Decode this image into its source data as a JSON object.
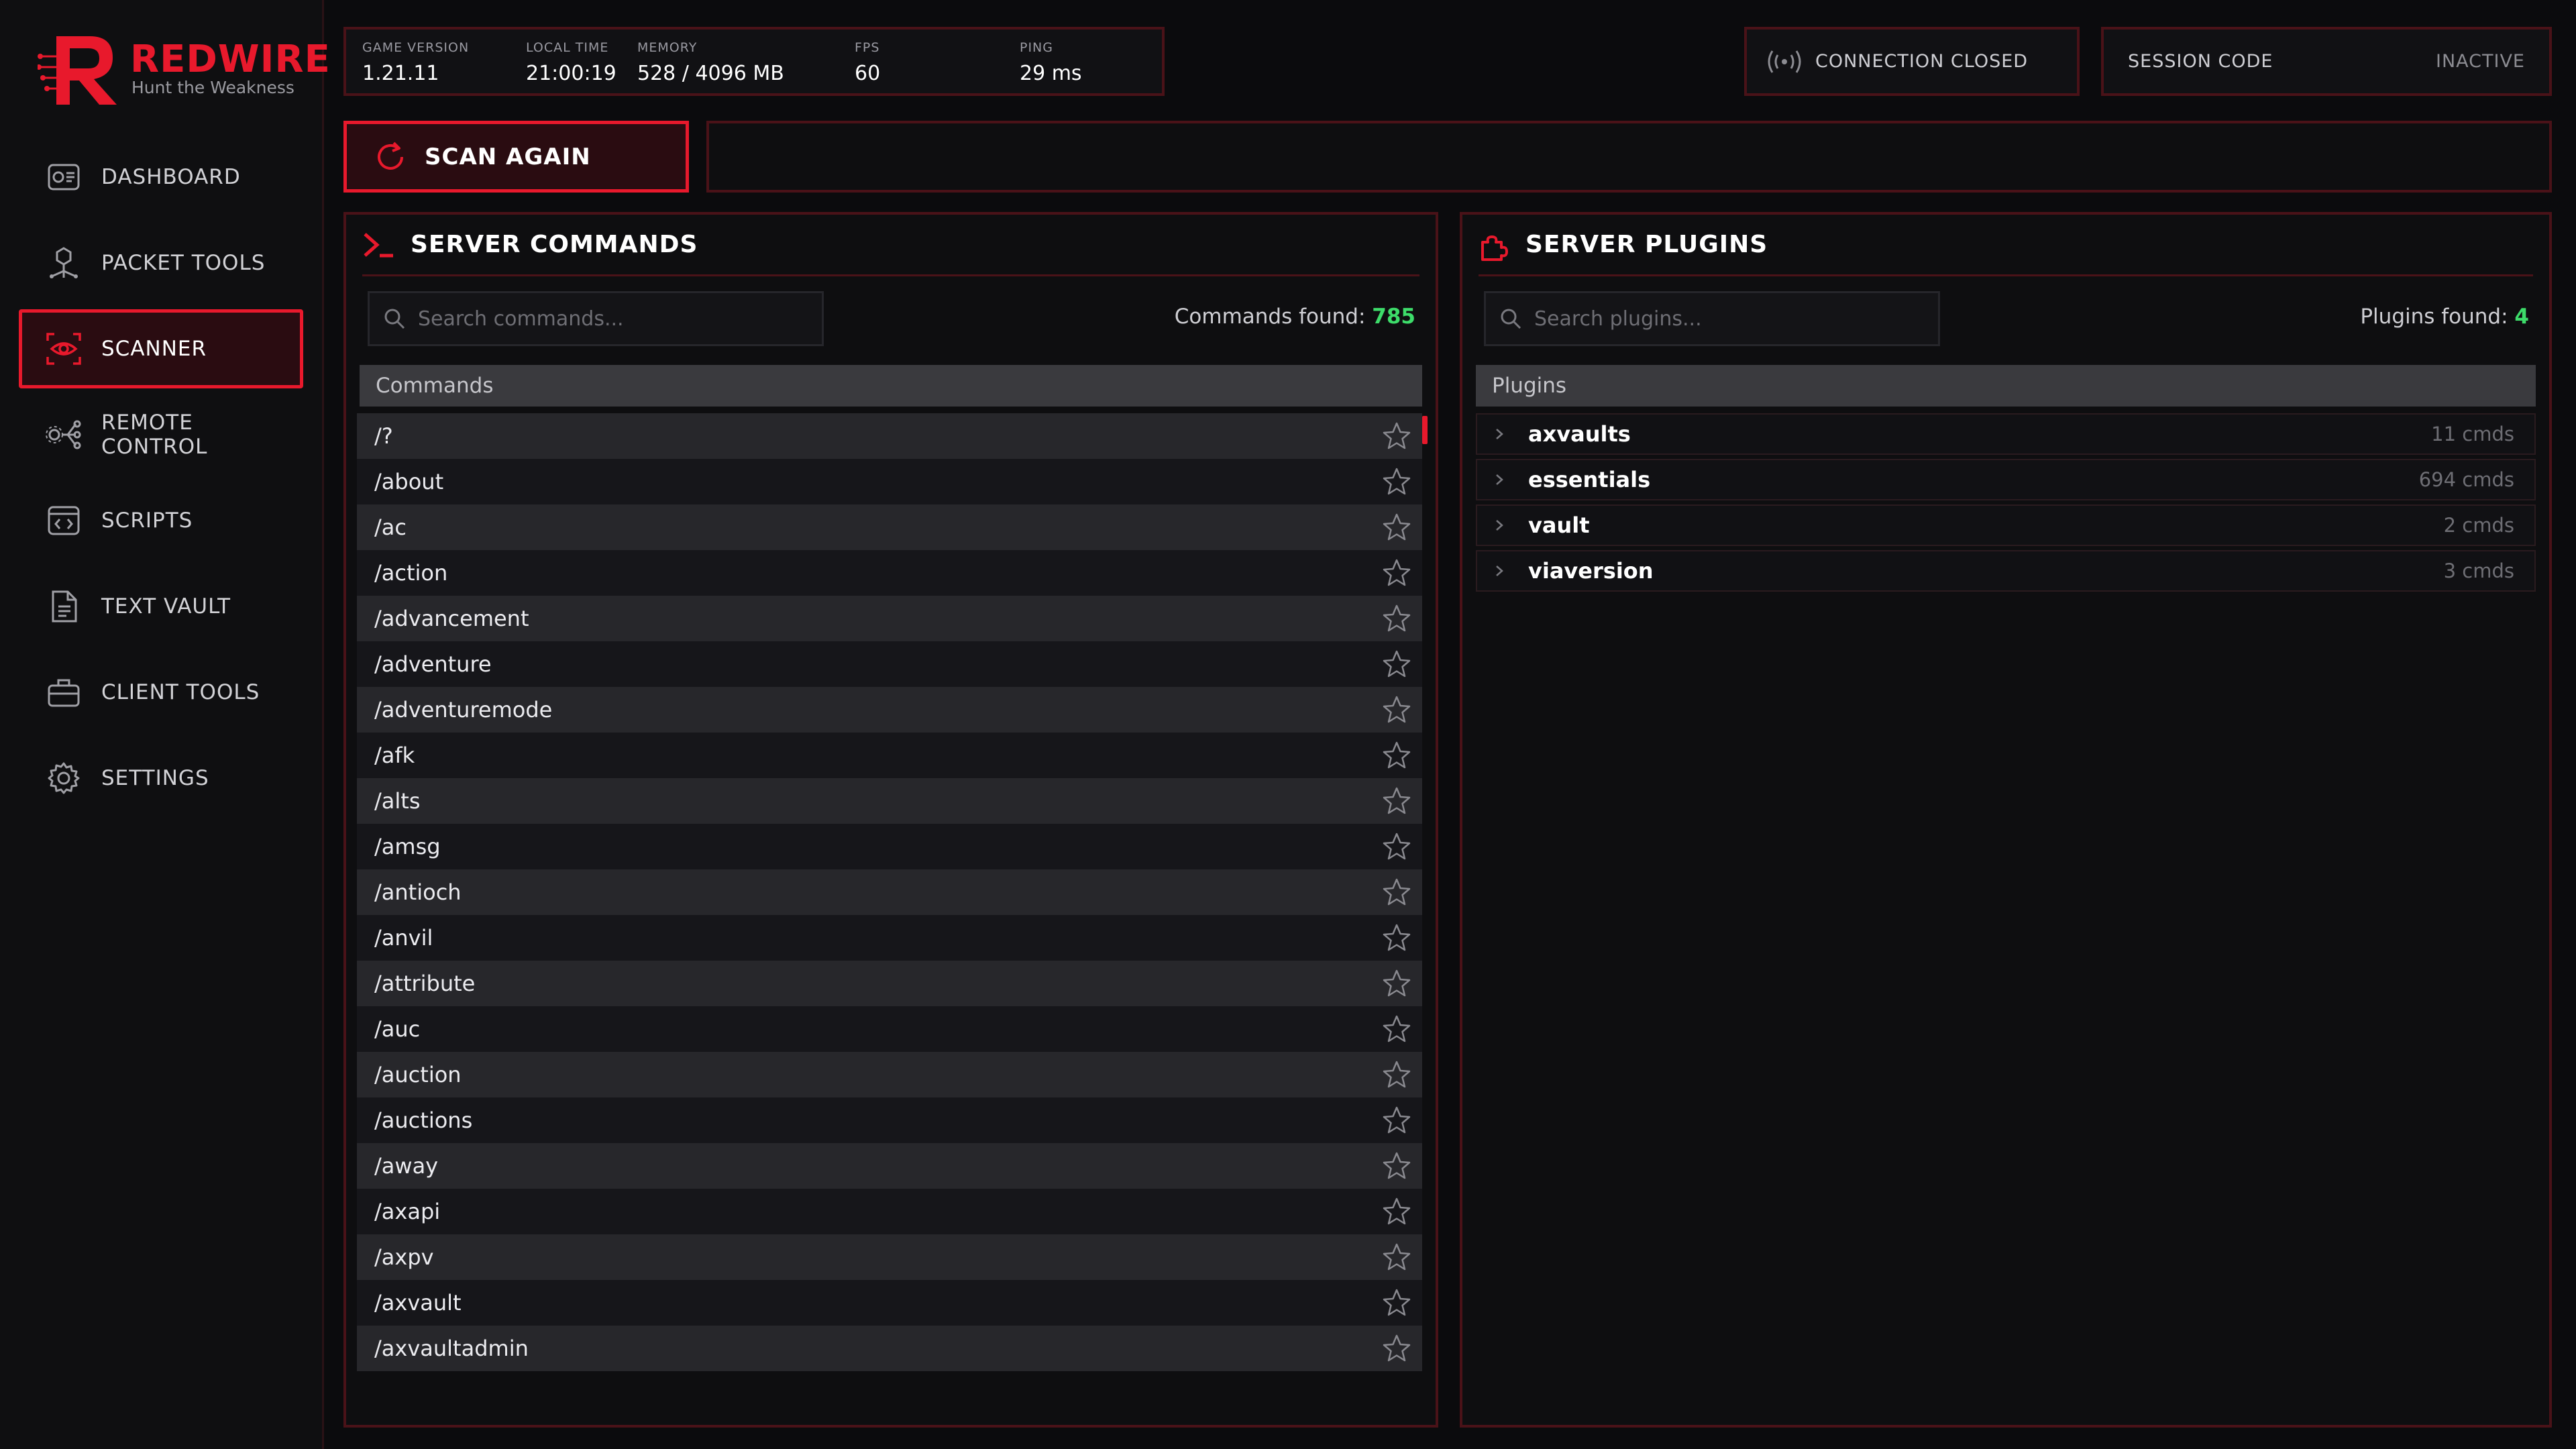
{
  "brand": {
    "name": "REDWIRE",
    "tagline": "Hunt the Weakness",
    "accent": "#e8192c"
  },
  "sidebar": {
    "items": [
      {
        "label": "DASHBOARD",
        "icon": "dashboard-icon"
      },
      {
        "label": "PACKET TOOLS",
        "icon": "network-icon"
      },
      {
        "label": "SCANNER",
        "icon": "eye-scan-icon",
        "active": true
      },
      {
        "label": "REMOTE CONTROL",
        "icon": "remote-icon"
      },
      {
        "label": "SCRIPTS",
        "icon": "code-window-icon"
      },
      {
        "label": "TEXT VAULT",
        "icon": "document-icon"
      },
      {
        "label": "CLIENT TOOLS",
        "icon": "toolbox-icon"
      },
      {
        "label": "SETTINGS",
        "icon": "gear-icon"
      }
    ]
  },
  "status": {
    "game_version": {
      "label": "GAME VERSION",
      "value": "1.21.11"
    },
    "local_time": {
      "label": "LOCAL TIME",
      "value": "21:00:19"
    },
    "memory": {
      "label": "MEMORY",
      "value": "528 / 4096 MB"
    },
    "fps": {
      "label": "FPS",
      "value": "60"
    },
    "ping": {
      "label": "PING",
      "value": "29 ms"
    }
  },
  "connection": {
    "label": "CONNECTION CLOSED",
    "icon": "broadcast-icon"
  },
  "session": {
    "label": "SESSION CODE",
    "value": "INACTIVE"
  },
  "scan": {
    "button_label": "SCAN AGAIN",
    "icon": "refresh-icon"
  },
  "commands_panel": {
    "title": "SERVER COMMANDS",
    "search_placeholder": "Search commands...",
    "found_label": "Commands found: ",
    "found_count": "785",
    "column_header": "Commands",
    "items": [
      "/?",
      "/about",
      "/ac",
      "/action",
      "/advancement",
      "/adventure",
      "/adventuremode",
      "/afk",
      "/alts",
      "/amsg",
      "/antioch",
      "/anvil",
      "/attribute",
      "/auc",
      "/auction",
      "/auctions",
      "/away",
      "/axapi",
      "/axpv",
      "/axvault",
      "/axvaultadmin"
    ]
  },
  "plugins_panel": {
    "title": "SERVER PLUGINS",
    "search_placeholder": "Search plugins...",
    "found_label": "Plugins found: ",
    "found_count": "4",
    "column_header": "Plugins",
    "items": [
      {
        "name": "axvaults",
        "count": "11 cmds"
      },
      {
        "name": "essentials",
        "count": "694 cmds"
      },
      {
        "name": "vault",
        "count": "2 cmds"
      },
      {
        "name": "viaversion",
        "count": "3 cmds"
      }
    ]
  }
}
